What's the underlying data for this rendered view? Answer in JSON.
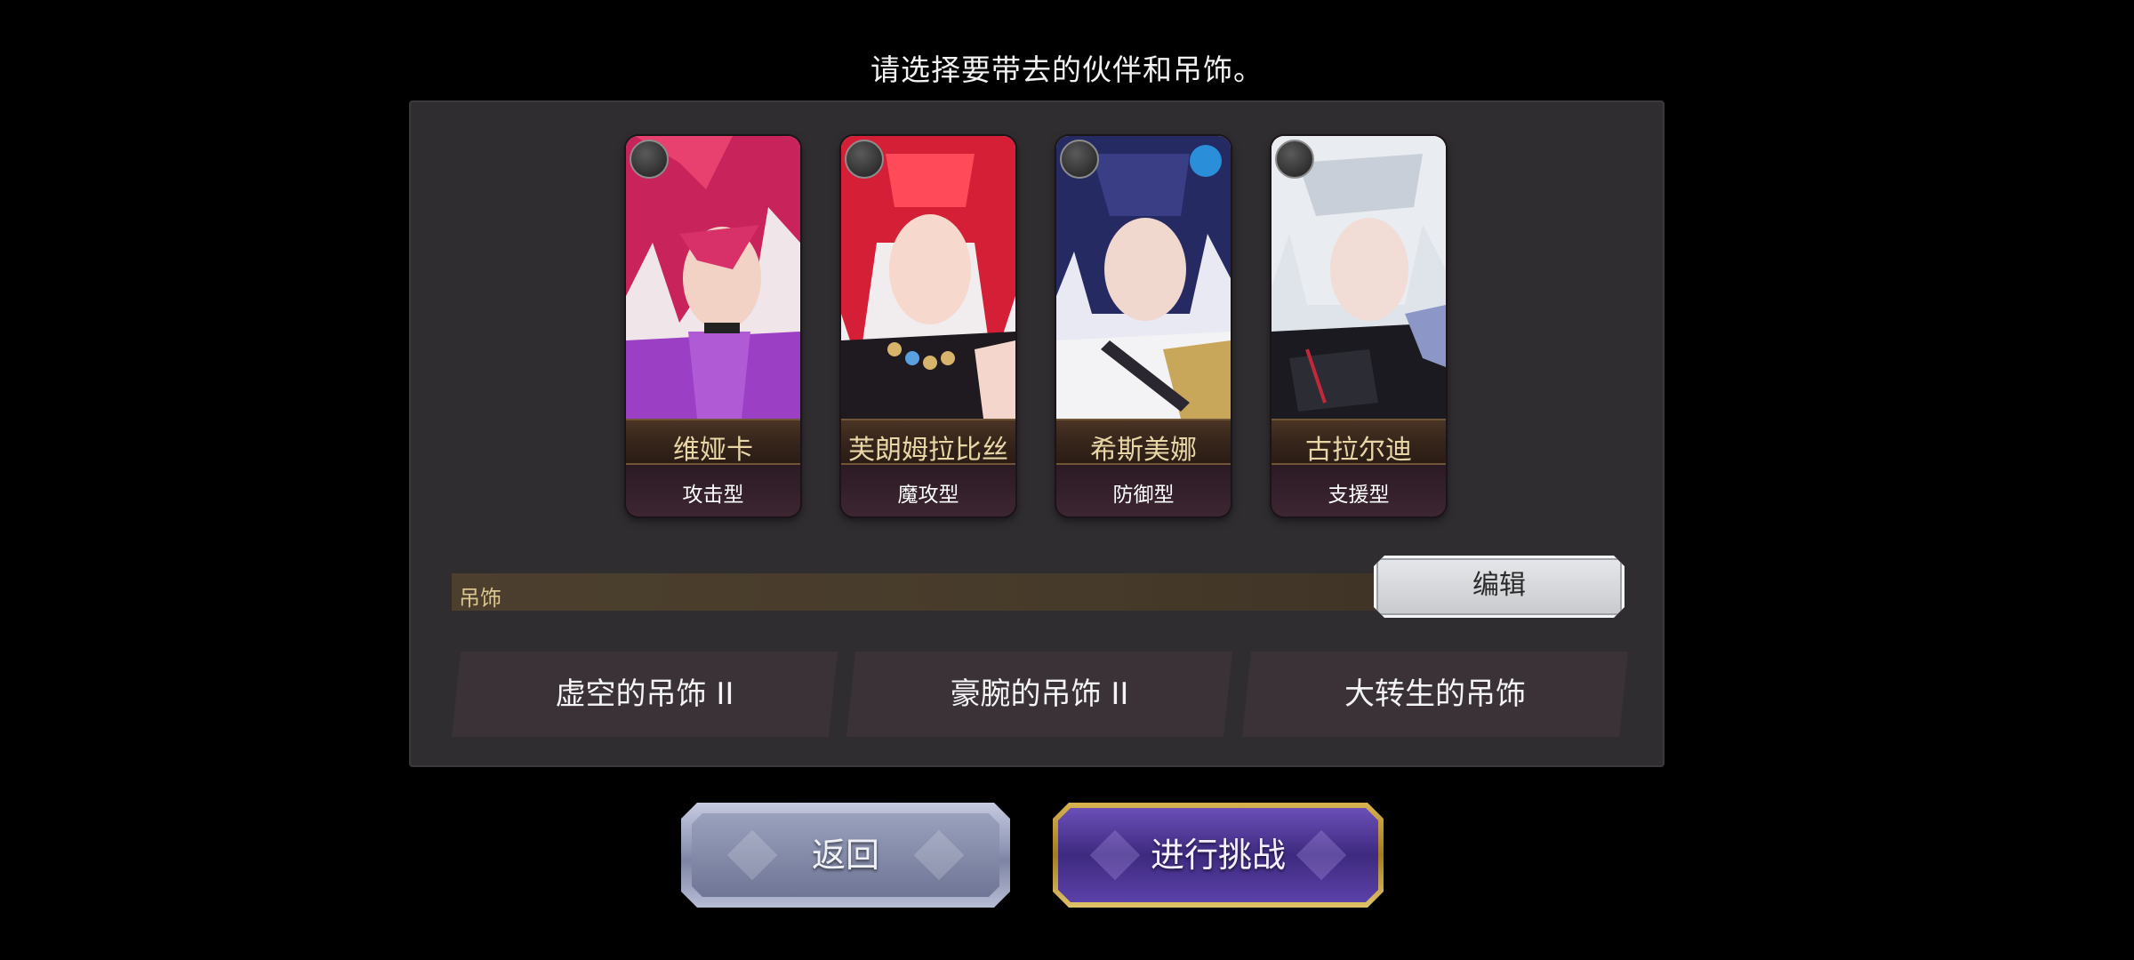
{
  "prompt": "请选择要带去的伙伴和吊饰。",
  "party": [
    {
      "name": "维娅卡",
      "type": "攻击型",
      "badge_icon": "sword-class-icon",
      "accent": "#a94fd0"
    },
    {
      "name": "芙朗姆拉比丝",
      "type": "魔攻型",
      "badge_icon": "staff-class-icon",
      "accent": "#d83048"
    },
    {
      "name": "希斯美娜",
      "type": "防御型",
      "badge_icon": "arrow-class-icon",
      "accent": "#2c3470"
    },
    {
      "name": "古拉尔迪",
      "type": "支援型",
      "badge_icon": "staff-class-icon",
      "accent": "#d8dbe0"
    }
  ],
  "accessory": {
    "label": "吊饰",
    "edit_label": "编辑",
    "items": [
      "虚空的吊饰 II",
      "豪腕的吊饰 II",
      "大转生的吊饰"
    ]
  },
  "buttons": {
    "back": "返回",
    "challenge": "进行挑战"
  }
}
